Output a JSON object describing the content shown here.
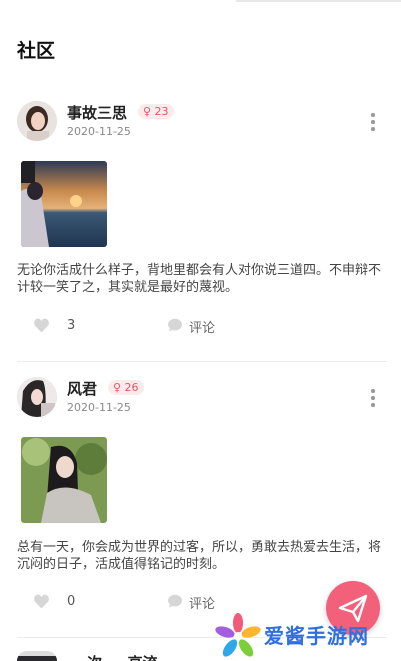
{
  "page": {
    "title": "社区"
  },
  "posts": [
    {
      "username": "事故三思",
      "badge": "♀ 23",
      "date": "2020-11-25",
      "content": "无论你活成什么样子，背地里都会有人对你说三道四。不申辩不计较一笑了之，其实就是最好的蔑视。",
      "likes": "3",
      "comment_label": "评论"
    },
    {
      "username": "风君",
      "badge": "♀ 26",
      "date": "2020-11-25",
      "content": "总有一天，你会成为世界的过客，所以，勇敢去热爱去生活，将沉闷的日子，活成值得铭记的时刻。",
      "likes": "0",
      "comment_label": "评论"
    },
    {
      "username": "… 次 — 高流"
    }
  ],
  "watermark": {
    "text": "爱酱手游网"
  },
  "colors": {
    "accent": "#f2607a",
    "badge_bg": "#fdeaea",
    "badge_text": "#e0556a"
  },
  "icons": {
    "like": "heart-icon",
    "comment": "comment-bubble-icon",
    "more": "more-vertical-icon",
    "compose": "paper-plane-icon"
  }
}
